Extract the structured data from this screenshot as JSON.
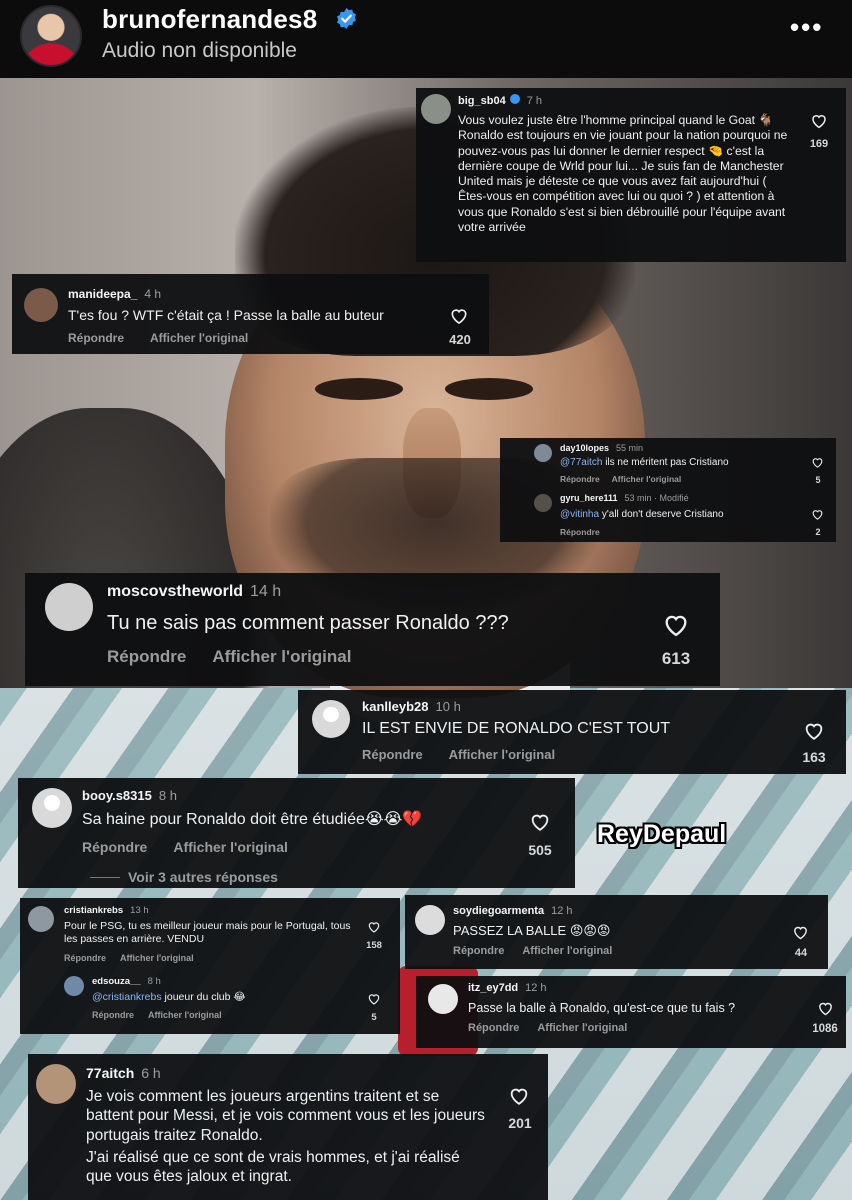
{
  "header": {
    "username": "brunofernandes8",
    "subtitle": "Audio non disponible",
    "more_label": "•••"
  },
  "watermark": "ReyDepaul",
  "actions": {
    "reply": "Répondre",
    "original": "Afficher l'original"
  },
  "comments": {
    "big_sb04": {
      "username": "big_sb04",
      "time": "7 h",
      "likes": "169",
      "text": "Vous voulez juste être l'homme principal quand le Goat 🐐 Ronaldo est toujours en vie jouant pour la nation pourquoi ne pouvez-vous pas lui donner le dernier respect 🤏 c'est la dernière coupe de Wrld pour lui... Je suis fan de Manchester United mais je déteste ce que vous avez fait aujourd'hui ( Êtes-vous en compétition avec lui ou quoi ? ) et attention à vous que Ronaldo s'est si bien débrouillé pour l'équipe avant votre arrivée"
    },
    "manideepa": {
      "username": "manideepa_",
      "time": "4 h",
      "likes": "420",
      "text": "T'es fou ? WTF c'était ça ! Passe la balle au buteur"
    },
    "day10lopes": {
      "username": "day10lopes",
      "time": "55 min",
      "likes": "5",
      "mention": "@77aitch",
      "text": "ils ne méritent pas Cristiano"
    },
    "gyru_here111": {
      "username": "gyru_here111",
      "time": "53 min · Modifié",
      "likes": "2",
      "mention": "@vitinha",
      "text": "y'all don't deserve Cristiano"
    },
    "moscovstheworld": {
      "username": "moscovstheworld",
      "time": "14 h",
      "likes": "613",
      "text": "Tu ne sais pas comment passer Ronaldo ???"
    },
    "kanlleyb28": {
      "username": "kanlleyb28",
      "time": "10 h",
      "likes": "163",
      "text": "IL EST ENVIE DE RONALDO C'EST TOUT"
    },
    "booy": {
      "username": "booy.s8315",
      "time": "8 h",
      "likes": "505",
      "text": "Sa haine pour Ronaldo doit être étudiée😭😭💔",
      "replies": "Voir 3 autres réponses"
    },
    "cristiankrebs": {
      "username": "cristiankrebs",
      "time": "13 h",
      "likes": "158",
      "text": "Pour le PSG, tu es meilleur joueur mais pour le Portugal, tous les passes en arrière. VENDU"
    },
    "edsouza": {
      "username": "edsouza__",
      "time": "8 h",
      "likes": "5",
      "mention": "@cristiankrebs",
      "text": "joueur du club 😂"
    },
    "soydiegoarmenta": {
      "username": "soydiegoarmenta",
      "time": "12 h",
      "likes": "44",
      "text": "PASSEZ LA BALLE 😡😡😡"
    },
    "itz_ey7dd": {
      "username": "itz_ey7dd",
      "time": "12 h",
      "likes": "1086",
      "text": "Passe la balle à Ronaldo, qu'est-ce que tu fais ?"
    },
    "aitch": {
      "username": "77aitch",
      "time": "6 h",
      "likes": "201",
      "text1": "Je vois comment les joueurs argentins traitent et se battent pour Messi, et je vois comment vous et les joueurs portugais traitez Ronaldo.",
      "text2": "J'ai réalisé que ce sont de vrais hommes, et j'ai réalisé que vous êtes jaloux et ingrat."
    }
  },
  "colors": {
    "card_bg": "#0e0f11",
    "header_bg": "#0c0c0d",
    "verified": "#3897f0",
    "action_text": "#9b9b9b"
  }
}
